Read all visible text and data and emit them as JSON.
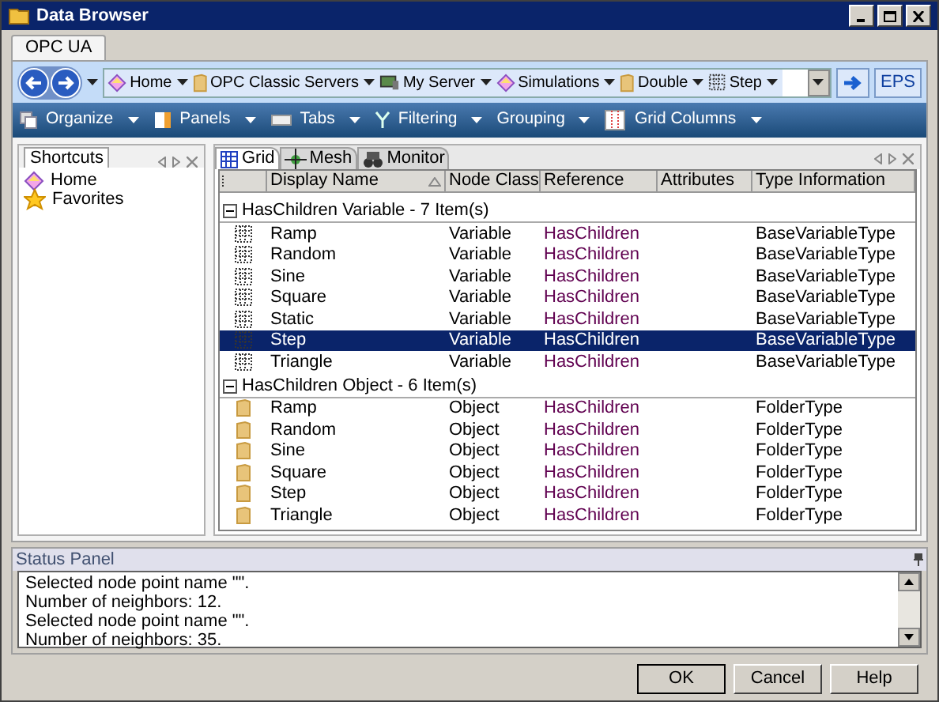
{
  "window": {
    "title": "Data Browser"
  },
  "tabs": [
    {
      "label": "OPC UA",
      "selected": true
    }
  ],
  "breadcrumb": [
    {
      "label": "Home",
      "kind": "home"
    },
    {
      "label": "OPC Classic Servers",
      "kind": "folder"
    },
    {
      "label": "My Server",
      "kind": "server"
    },
    {
      "label": "Simulations",
      "kind": "home"
    },
    {
      "label": "Double",
      "kind": "folder"
    },
    {
      "label": "Step",
      "kind": "variable"
    }
  ],
  "eps_button": "EPS",
  "toolbar": [
    {
      "label": "Organize",
      "kind": "organize"
    },
    {
      "label": "Panels",
      "kind": "panels"
    },
    {
      "label": "Tabs",
      "kind": "tabs"
    },
    {
      "label": "Filtering",
      "kind": "filter"
    },
    {
      "label": "Grouping",
      "kind": "plain"
    },
    {
      "label": "Grid Columns",
      "kind": "columns"
    }
  ],
  "shortcuts": {
    "title": "Shortcuts",
    "items": [
      {
        "label": "Home",
        "kind": "home"
      },
      {
        "label": "Favorites",
        "kind": "star"
      }
    ]
  },
  "view_tabs": [
    {
      "label": "Grid",
      "kind": "grid",
      "selected": true
    },
    {
      "label": "Mesh",
      "kind": "mesh",
      "selected": false
    },
    {
      "label": "Monitor",
      "kind": "monitor",
      "selected": false
    }
  ],
  "table": {
    "columns": [
      "Display Name",
      "Node Class",
      "Reference",
      "Attributes",
      "Type Information"
    ],
    "groups": [
      {
        "title": "HasChildren Variable - 7 Item(s)",
        "rows": [
          {
            "kind": "variable",
            "display_name": "Ramp",
            "node_class": "Variable",
            "reference": "HasChildren",
            "type_information": "BaseVariableType",
            "selected": false
          },
          {
            "kind": "variable",
            "display_name": "Random",
            "node_class": "Variable",
            "reference": "HasChildren",
            "type_information": "BaseVariableType",
            "selected": false
          },
          {
            "kind": "variable",
            "display_name": "Sine",
            "node_class": "Variable",
            "reference": "HasChildren",
            "type_information": "BaseVariableType",
            "selected": false
          },
          {
            "kind": "variable",
            "display_name": "Square",
            "node_class": "Variable",
            "reference": "HasChildren",
            "type_information": "BaseVariableType",
            "selected": false
          },
          {
            "kind": "variable",
            "display_name": "Static",
            "node_class": "Variable",
            "reference": "HasChildren",
            "type_information": "BaseVariableType",
            "selected": false
          },
          {
            "kind": "variable",
            "display_name": "Step",
            "node_class": "Variable",
            "reference": "HasChildren",
            "type_information": "BaseVariableType",
            "selected": true
          },
          {
            "kind": "variable",
            "display_name": "Triangle",
            "node_class": "Variable",
            "reference": "HasChildren",
            "type_information": "BaseVariableType",
            "selected": false
          }
        ]
      },
      {
        "title": "HasChildren Object - 6 Item(s)",
        "rows": [
          {
            "kind": "object",
            "display_name": "Ramp",
            "node_class": "Object",
            "reference": "HasChildren",
            "type_information": "FolderType",
            "selected": false
          },
          {
            "kind": "object",
            "display_name": "Random",
            "node_class": "Object",
            "reference": "HasChildren",
            "type_information": "FolderType",
            "selected": false
          },
          {
            "kind": "object",
            "display_name": "Sine",
            "node_class": "Object",
            "reference": "HasChildren",
            "type_information": "FolderType",
            "selected": false
          },
          {
            "kind": "object",
            "display_name": "Square",
            "node_class": "Object",
            "reference": "HasChildren",
            "type_information": "FolderType",
            "selected": false
          },
          {
            "kind": "object",
            "display_name": "Step",
            "node_class": "Object",
            "reference": "HasChildren",
            "type_information": "FolderType",
            "selected": false
          },
          {
            "kind": "object",
            "display_name": "Triangle",
            "node_class": "Object",
            "reference": "HasChildren",
            "type_information": "FolderType",
            "selected": false
          }
        ]
      }
    ]
  },
  "status_panel": {
    "title": "Status Panel",
    "lines": [
      "Selected node point name \"\".",
      "Number of neighbors: 12.",
      "Selected node point name \"\".",
      "Number of neighbors: 35."
    ]
  },
  "buttons": [
    "OK",
    "Cancel",
    "Help"
  ]
}
